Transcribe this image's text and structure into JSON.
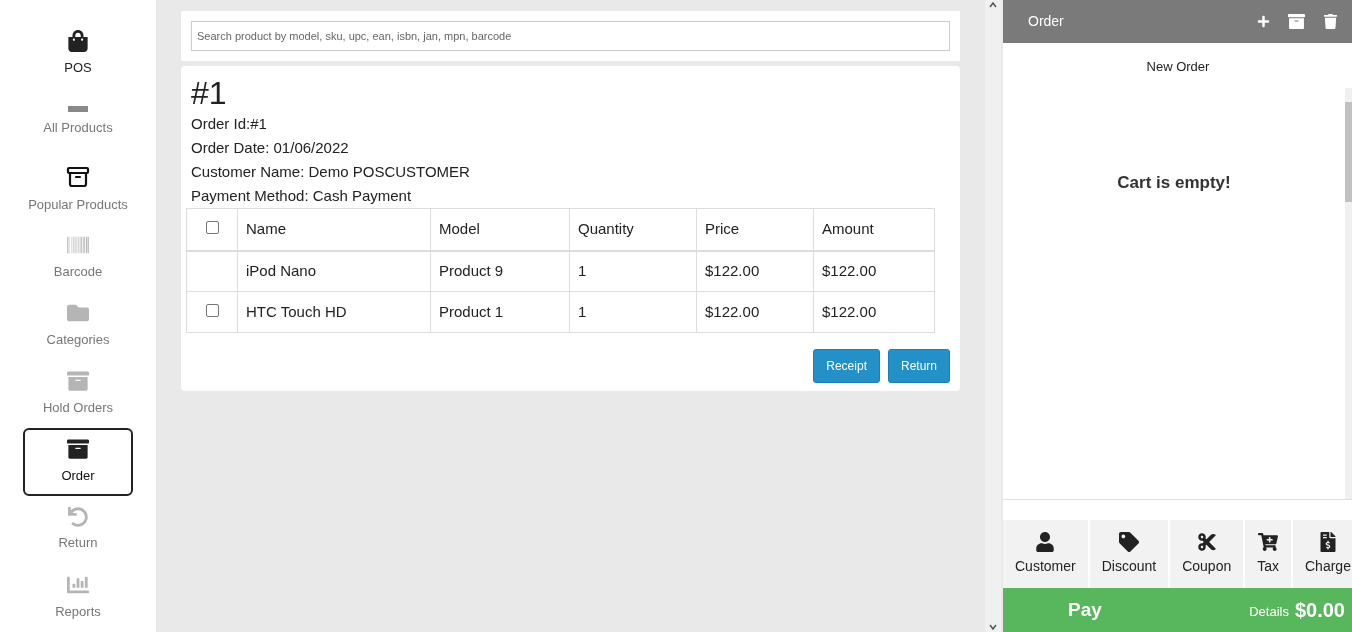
{
  "sidebar": {
    "items": [
      {
        "kind": "bag",
        "label": "POS",
        "selected": false
      },
      {
        "kind": "bar",
        "label": "All Products",
        "selected": false
      },
      {
        "kind": "box",
        "label": "Popular Products",
        "selected": false
      },
      {
        "kind": "barcode",
        "label": "Barcode",
        "selected": false
      },
      {
        "kind": "folder",
        "label": "Categories",
        "selected": false
      },
      {
        "kind": "archive",
        "label": "Hold Orders",
        "selected": false
      },
      {
        "kind": "archive",
        "label": "Order",
        "selected": true
      },
      {
        "kind": "undo",
        "label": "Return",
        "selected": false
      },
      {
        "kind": "chart",
        "label": "Reports",
        "selected": false
      }
    ]
  },
  "search": {
    "placeholder": "Search product by model, sku, upc, ean, isbn, jan, mpn, barcode"
  },
  "order": {
    "title": "#1",
    "details": [
      "Order Id:#1",
      "Order Date: 01/06/2022",
      "Customer Name: Demo POSCUSTOMER",
      "Payment Method: Cash Payment"
    ],
    "table": {
      "header_checked": false,
      "columns": [
        "Name",
        "Model",
        "Quantity",
        "Price",
        "Amount"
      ],
      "rows": [
        {
          "kind": "plain",
          "cells": [
            "iPod Nano",
            "Product 9",
            "1",
            "$122.00",
            "$122.00"
          ]
        },
        {
          "kind": "selectable",
          "checked": false,
          "cells": [
            "HTC Touch HD",
            "Product 1",
            "1",
            "$122.00",
            "$122.00"
          ]
        }
      ]
    },
    "buttons": [
      "Receipt",
      "Return"
    ]
  },
  "cart": {
    "title": "Order",
    "subtitle": "New Order",
    "empty_message": "Cart is empty!",
    "actions": [
      {
        "kind": "user",
        "label": "Customer"
      },
      {
        "kind": "tag",
        "label": "Discount"
      },
      {
        "kind": "cut",
        "label": "Coupon"
      },
      {
        "kind": "cart",
        "label": "Tax"
      },
      {
        "kind": "invoice",
        "label": "Charge"
      }
    ],
    "pay": {
      "label": "Pay",
      "details": "Details",
      "total": "$0.00"
    }
  }
}
